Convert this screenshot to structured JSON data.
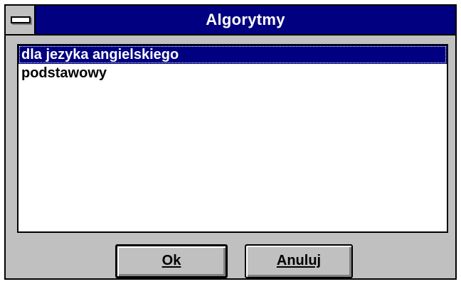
{
  "window": {
    "title": "Algorytmy"
  },
  "list": {
    "items": [
      {
        "label": "dla jezyka angielskiego",
        "selected": true
      },
      {
        "label": "podstawowy",
        "selected": false
      }
    ]
  },
  "buttons": {
    "ok_label": "Ok",
    "cancel_label": "Anuluj"
  },
  "colors": {
    "titlebar": "#000080",
    "face": "#c0c0c0",
    "selection": "#000080"
  },
  "icons": {
    "system_menu": "system-menu-icon"
  }
}
